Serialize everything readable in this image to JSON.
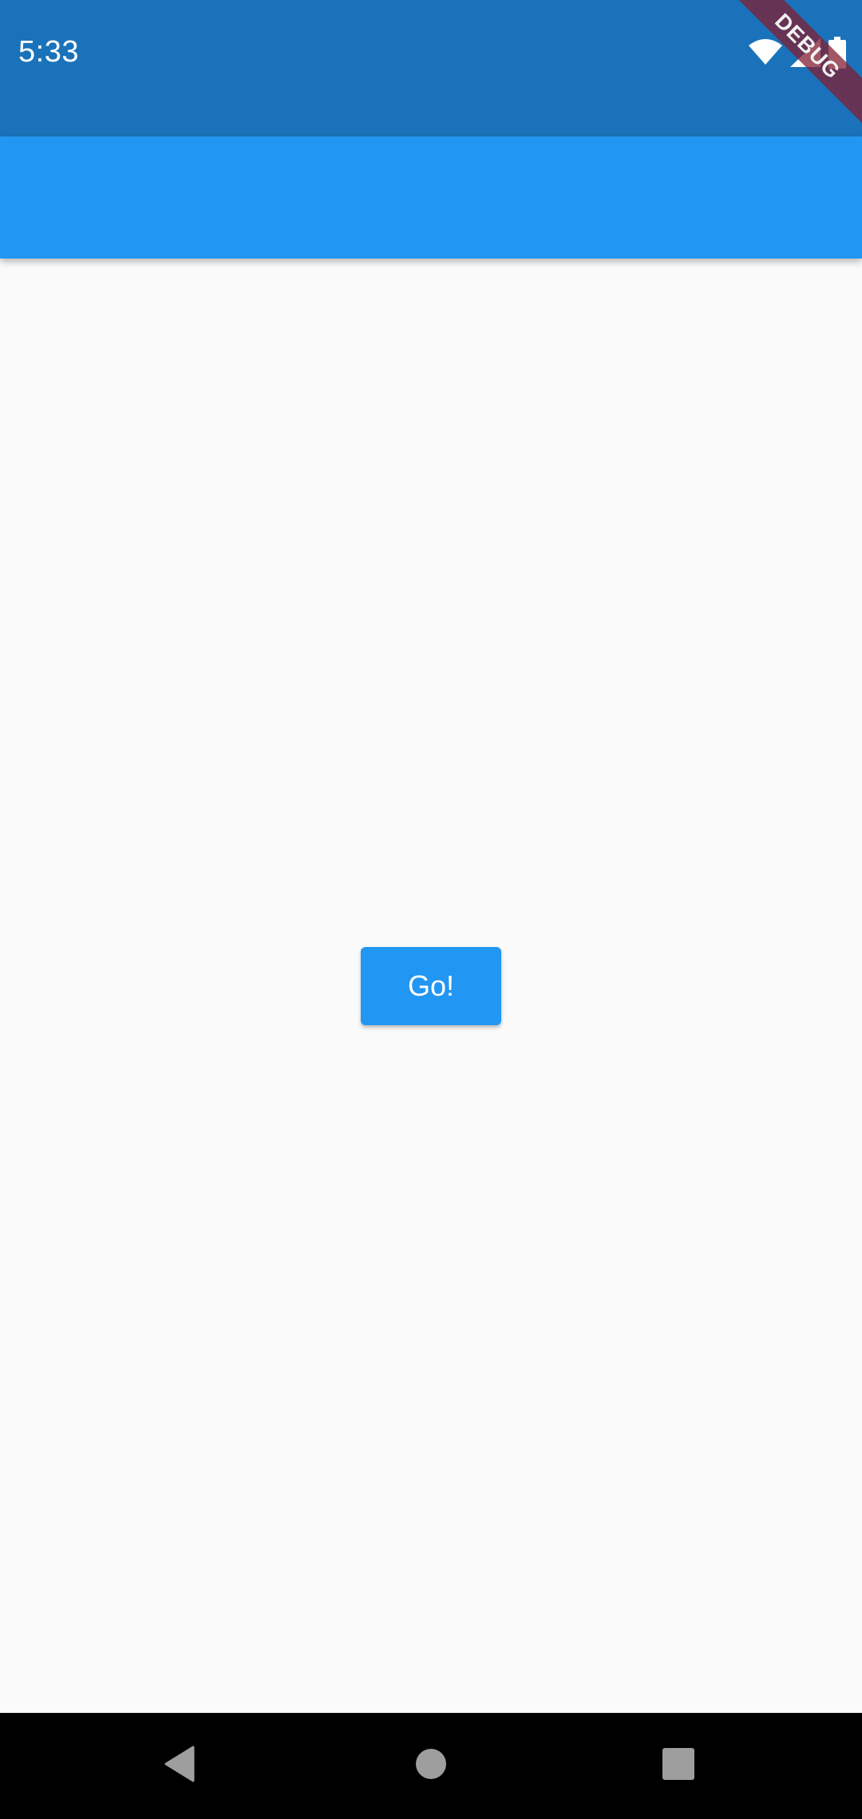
{
  "status_bar": {
    "time": "5:33",
    "icons": [
      "wifi-icon",
      "cell-signal-icon",
      "battery-icon"
    ]
  },
  "debug_banner": {
    "label": "DEBUG"
  },
  "main": {
    "go_button_label": "Go!"
  },
  "nav_bar": {
    "icons": [
      "back-icon",
      "home-icon",
      "recents-icon"
    ]
  },
  "colors": {
    "status_bar": "#1a73ba",
    "app_bar": "#2196f3",
    "button": "#2196f3",
    "background": "#fafafa",
    "nav_bar": "#000000",
    "debug_ribbon": "#821e32"
  }
}
